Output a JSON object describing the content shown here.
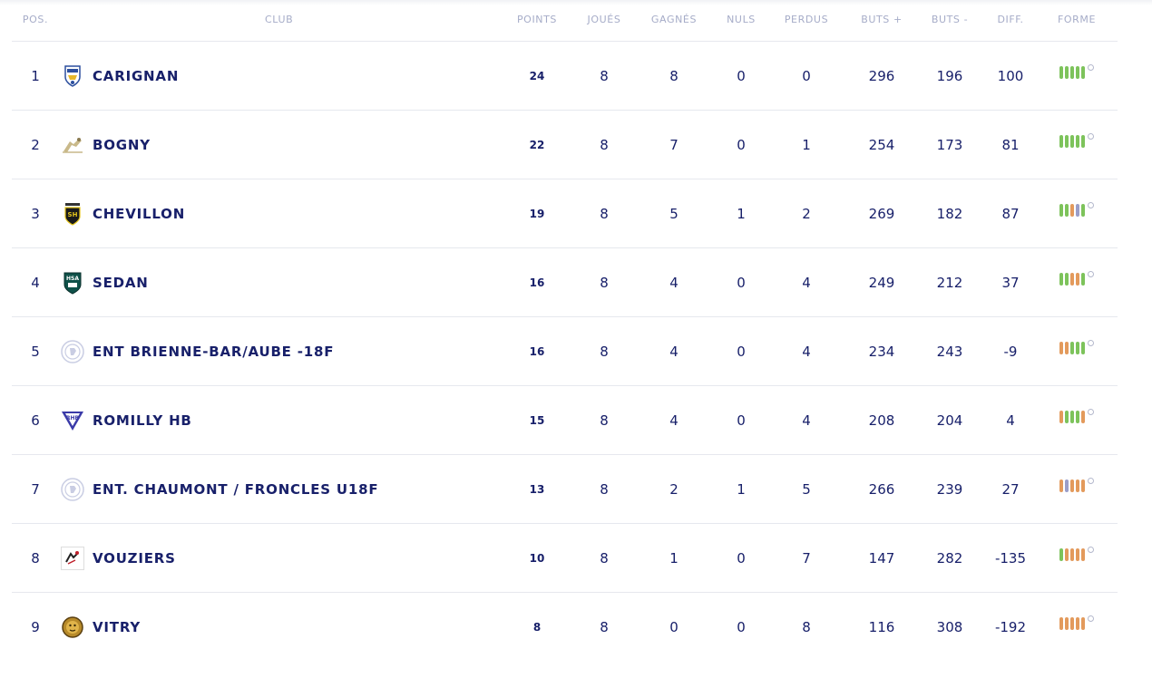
{
  "colors": {
    "text": "#18206a",
    "header_text": "#a6acc8",
    "win": "#7dc35b",
    "draw": "#9a9ec9",
    "loss": "#e39a5c"
  },
  "header": {
    "pos": "POS.",
    "club": "CLUB",
    "points": "POINTS",
    "played": "JOUÉS",
    "won": "GAGNÉS",
    "drawn": "NULS",
    "lost": "PERDUS",
    "goals_for": "BUTS +",
    "goals_against": "BUTS -",
    "diff": "DIFF.",
    "form": "FORME"
  },
  "rows": [
    {
      "pos": "1",
      "club": "CARIGNAN",
      "logo": "carignan-logo",
      "points": "24",
      "played": "8",
      "won": "8",
      "drawn": "0",
      "lost": "0",
      "gf": "296",
      "ga": "196",
      "diff": "100",
      "form": [
        "W",
        "W",
        "W",
        "W",
        "W"
      ]
    },
    {
      "pos": "2",
      "club": "BOGNY",
      "logo": "bogny-logo",
      "points": "22",
      "played": "8",
      "won": "7",
      "drawn": "0",
      "lost": "1",
      "gf": "254",
      "ga": "173",
      "diff": "81",
      "form": [
        "W",
        "W",
        "W",
        "W",
        "W"
      ]
    },
    {
      "pos": "3",
      "club": "CHEVILLON",
      "logo": "chevillon-logo",
      "points": "19",
      "played": "8",
      "won": "5",
      "drawn": "1",
      "lost": "2",
      "gf": "269",
      "ga": "182",
      "diff": "87",
      "form": [
        "W",
        "W",
        "L",
        "D",
        "W"
      ]
    },
    {
      "pos": "4",
      "club": "SEDAN",
      "logo": "sedan-logo",
      "points": "16",
      "played": "8",
      "won": "4",
      "drawn": "0",
      "lost": "4",
      "gf": "249",
      "ga": "212",
      "diff": "37",
      "form": [
        "W",
        "W",
        "L",
        "L",
        "W"
      ]
    },
    {
      "pos": "5",
      "club": "ENT BRIENNE-BAR/AUBE -18F",
      "logo": "default-club-logo",
      "points": "16",
      "played": "8",
      "won": "4",
      "drawn": "0",
      "lost": "4",
      "gf": "234",
      "ga": "243",
      "diff": "-9",
      "form": [
        "L",
        "L",
        "W",
        "W",
        "W"
      ]
    },
    {
      "pos": "6",
      "club": "ROMILLY HB",
      "logo": "romilly-logo",
      "points": "15",
      "played": "8",
      "won": "4",
      "drawn": "0",
      "lost": "4",
      "gf": "208",
      "ga": "204",
      "diff": "4",
      "form": [
        "L",
        "W",
        "W",
        "W",
        "L"
      ]
    },
    {
      "pos": "7",
      "club": "ENT. CHAUMONT / FRONCLES U18F",
      "logo": "default-club-logo",
      "points": "13",
      "played": "8",
      "won": "2",
      "drawn": "1",
      "lost": "5",
      "gf": "266",
      "ga": "239",
      "diff": "27",
      "form": [
        "L",
        "D",
        "L",
        "L",
        "L"
      ]
    },
    {
      "pos": "8",
      "club": "VOUZIERS",
      "logo": "vouziers-logo",
      "points": "10",
      "played": "8",
      "won": "1",
      "drawn": "0",
      "lost": "7",
      "gf": "147",
      "ga": "282",
      "diff": "-135",
      "form": [
        "W",
        "L",
        "L",
        "L",
        "L"
      ]
    },
    {
      "pos": "9",
      "club": "VITRY",
      "logo": "vitry-logo",
      "points": "8",
      "played": "8",
      "won": "0",
      "drawn": "0",
      "lost": "8",
      "gf": "116",
      "ga": "308",
      "diff": "-192",
      "form": [
        "L",
        "L",
        "L",
        "L",
        "L"
      ]
    }
  ]
}
